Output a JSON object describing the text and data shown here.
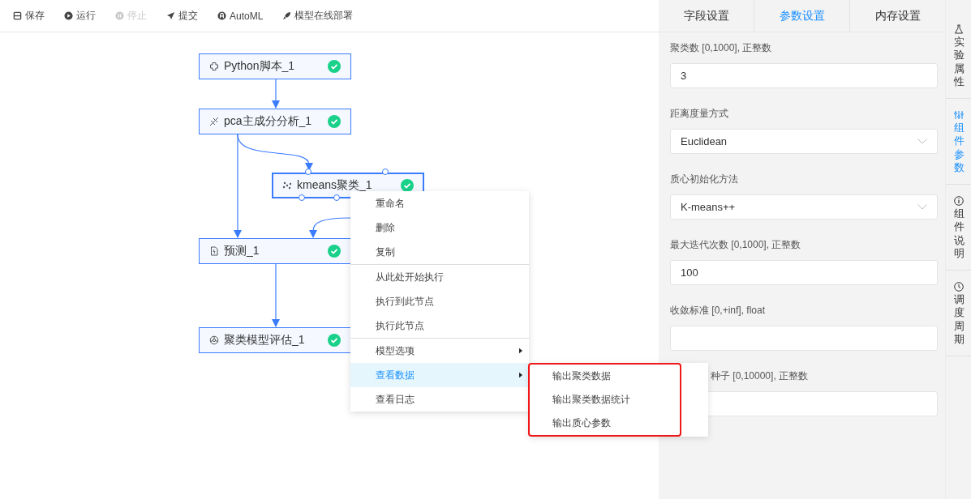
{
  "toolbar": [
    {
      "label": "保存",
      "kind": "save",
      "disabled": false
    },
    {
      "label": "运行",
      "kind": "run",
      "disabled": false
    },
    {
      "label": "停止",
      "kind": "stop",
      "disabled": true
    },
    {
      "label": "提交",
      "kind": "submit",
      "disabled": false
    },
    {
      "label": "AutoML",
      "kind": "automl",
      "disabled": false
    },
    {
      "label": "模型在线部署",
      "kind": "deploy",
      "disabled": false
    }
  ],
  "canvas": {
    "nodes": [
      {
        "label": "Python脚本_1",
        "kind": "script",
        "done": true,
        "selected": false
      },
      {
        "label": "pca主成分分析_1",
        "kind": "pca",
        "done": true,
        "selected": false
      },
      {
        "label": "kmeans聚类_1",
        "kind": "cluster",
        "done": true,
        "selected": true
      },
      {
        "label": "预测_1",
        "kind": "predict",
        "done": true,
        "selected": false
      },
      {
        "label": "聚类模型评估_1",
        "kind": "evaluate",
        "done": true,
        "selected": false
      }
    ]
  },
  "context_menu": {
    "groups": [
      [
        {
          "label": "重命名",
          "selected": false,
          "has_submenu": false
        },
        {
          "label": "删除",
          "selected": false,
          "has_submenu": false
        },
        {
          "label": "复制",
          "selected": false,
          "has_submenu": false
        }
      ],
      [
        {
          "label": "从此处开始执行",
          "selected": false,
          "has_submenu": false
        },
        {
          "label": "执行到此节点",
          "selected": false,
          "has_submenu": false
        },
        {
          "label": "执行此节点",
          "selected": false,
          "has_submenu": false
        }
      ],
      [
        {
          "label": "模型选项",
          "selected": false,
          "has_submenu": true
        },
        {
          "label": "查看数据",
          "selected": true,
          "has_submenu": true
        },
        {
          "label": "查看日志",
          "selected": false,
          "has_submenu": false
        }
      ]
    ],
    "submenu": {
      "annotated": true,
      "items": [
        {
          "label": "输出聚类数据"
        },
        {
          "label": "输出聚类数据统计"
        },
        {
          "label": "输出质心参数"
        }
      ]
    }
  },
  "panel": {
    "tabs": [
      {
        "label": "字段设置",
        "selected": false
      },
      {
        "label": "参数设置",
        "selected": true
      },
      {
        "label": "内存设置",
        "selected": false
      }
    ],
    "fields": [
      {
        "label": "聚类数 [0,1000], 正整数",
        "kind": "input",
        "value": "3"
      },
      {
        "label": "距离度量方式",
        "kind": "select",
        "value": "Euclidean"
      },
      {
        "label": "质心初始化方法",
        "kind": "select",
        "value": "K-means++"
      },
      {
        "label": "最大迭代次数 [0,1000], 正整数",
        "kind": "input",
        "value": "100"
      },
      {
        "label": "收敛标准 [0,+inf], float",
        "kind": "input"
      },
      {
        "label": "种子 [0,10000], 正整数",
        "kind": "input",
        "covered": true
      }
    ]
  },
  "side_tabs": [
    {
      "label": "实验属性",
      "kind": "flask",
      "selected": false
    },
    {
      "label": "组件参数",
      "kind": "sliders",
      "selected": true
    },
    {
      "label": "组件说明",
      "kind": "info",
      "selected": false
    },
    {
      "label": "调度周期",
      "kind": "clock",
      "selected": false
    }
  ]
}
